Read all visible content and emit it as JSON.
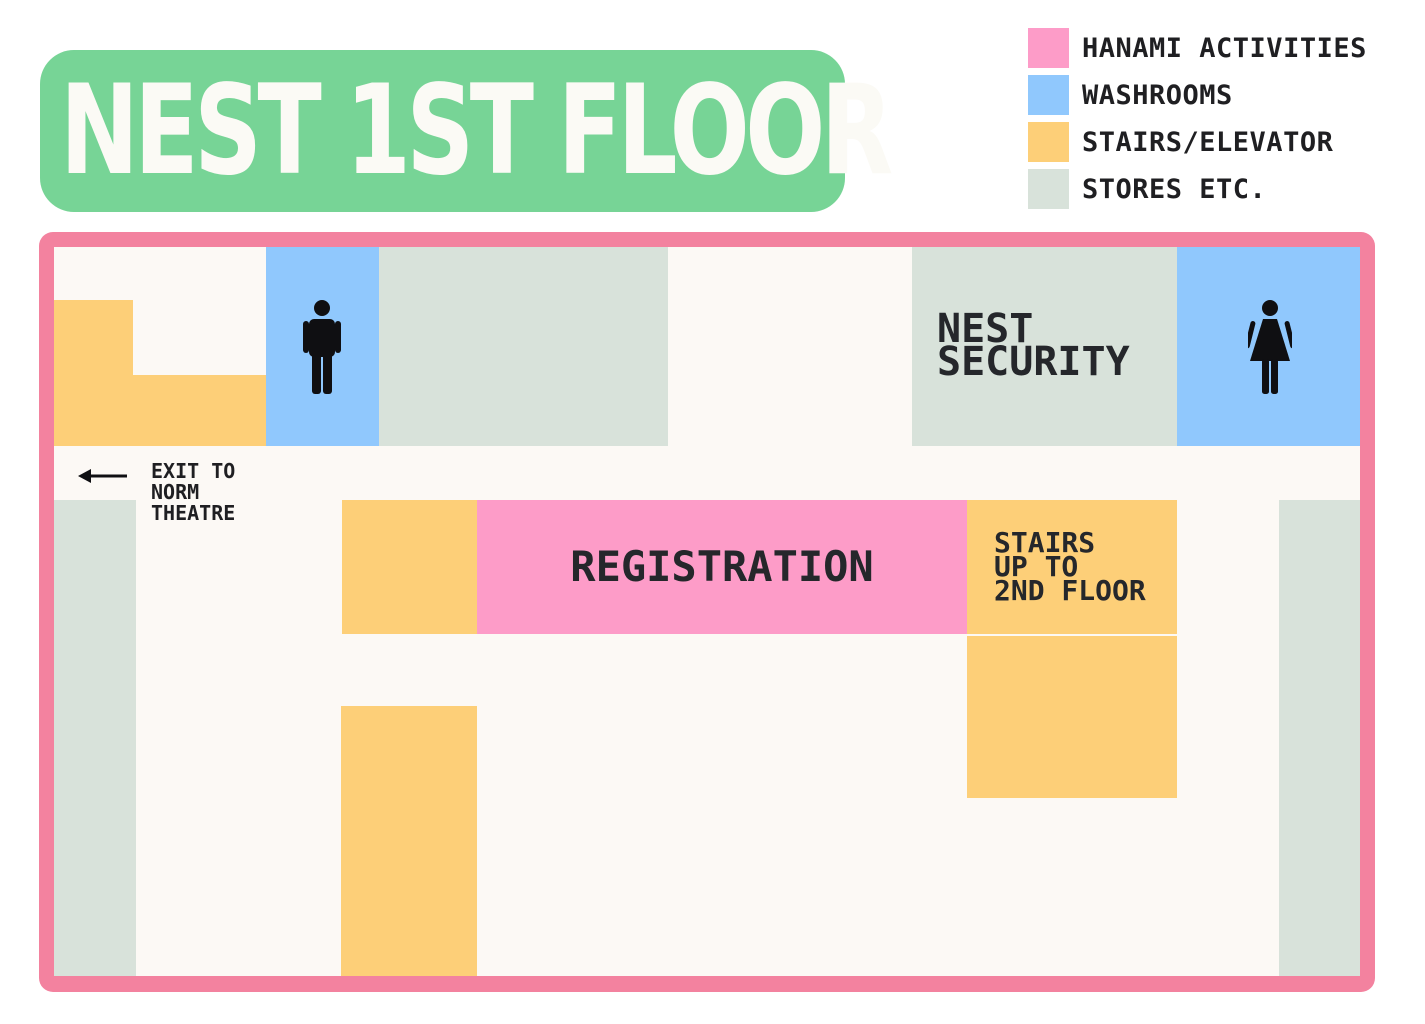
{
  "title": "NEST 1ST FLOOR",
  "legend": [
    {
      "label": "HANAMI ACTIVITIES",
      "color": "#fd9cc8"
    },
    {
      "label": "WASHROOMS",
      "color": "#90c8fd"
    },
    {
      "label": "STAIRS/ELEVATOR",
      "color": "#fdcf78"
    },
    {
      "label": "STORES ETC.",
      "color": "#d8e2da"
    }
  ],
  "colors": {
    "title_background": "#77d496",
    "title_text": "#fbfaf5",
    "map_border": "#f3829f",
    "floor": "#fcf9f5"
  },
  "map": {
    "security_line1": "NEST",
    "security_line2": "SECURITY",
    "registration": "REGISTRATION",
    "stairs_line1": "STAIRS",
    "stairs_line2": "UP TO",
    "stairs_line3": "2ND FLOOR",
    "exit_line1": "EXIT TO",
    "exit_line2": "NORM",
    "exit_line3": "THEATRE",
    "mens_washroom_icon": "man-icon",
    "womens_washroom_icon": "woman-icon",
    "exit_arrow_icon": "left-arrow-icon"
  }
}
